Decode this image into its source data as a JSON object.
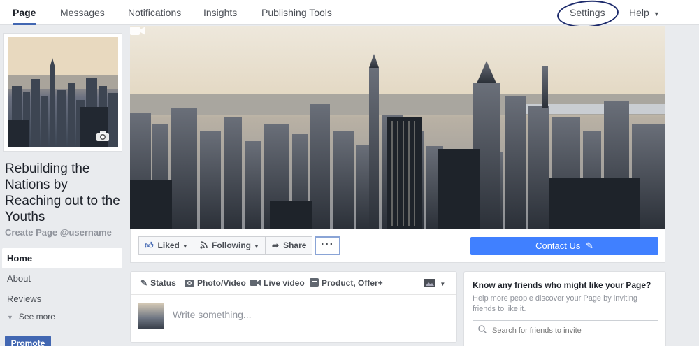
{
  "topnav": {
    "tabs": [
      {
        "label": "Page"
      },
      {
        "label": "Messages"
      },
      {
        "label": "Notifications"
      },
      {
        "label": "Insights"
      },
      {
        "label": "Publishing Tools"
      }
    ],
    "settings": "Settings",
    "help": "Help"
  },
  "page": {
    "name": "Rebuilding the Nations by Reaching out to the Youths",
    "handle": "Create Page @username"
  },
  "leftnav": {
    "items": [
      {
        "label": "Home"
      },
      {
        "label": "About"
      },
      {
        "label": "Reviews"
      }
    ],
    "see_more": "See more",
    "promote": "Promote"
  },
  "actions": {
    "liked": "Liked",
    "following": "Following",
    "share": "Share",
    "more": "···",
    "contact": "Contact Us"
  },
  "composer": {
    "tabs": [
      {
        "label": "Status",
        "icon": "pencil-icon"
      },
      {
        "label": "Photo/Video",
        "icon": "camera-icon"
      },
      {
        "label": "Live video",
        "icon": "video-camera-icon"
      },
      {
        "label": "Product, Offer+",
        "icon": "product-icon"
      }
    ],
    "placeholder": "Write something..."
  },
  "friends": {
    "title": "Know any friends who might like your Page?",
    "description": "Help more people discover your Page by inviting friends to like it.",
    "search_placeholder": "Search for friends to invite"
  },
  "colors": {
    "accent": "#4267b2",
    "contact_button": "#4080ff",
    "background": "#e9ebee",
    "annotation_ring": "#1c2a6b"
  }
}
